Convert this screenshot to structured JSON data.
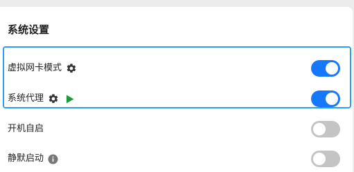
{
  "section": {
    "title": "系统设置"
  },
  "settings": [
    {
      "label": "虚拟网卡模式",
      "enabled": true,
      "icons": [
        "gear-icon"
      ]
    },
    {
      "label": "系统代理",
      "enabled": true,
      "icons": [
        "gear-icon",
        "play-icon"
      ]
    },
    {
      "label": "开机自启",
      "enabled": false,
      "icons": []
    },
    {
      "label": "静默启动",
      "enabled": false,
      "icons": [
        "info-icon"
      ]
    }
  ],
  "colors": {
    "toggle_on": "#1677ff",
    "toggle_off": "#c4c4c4",
    "highlight_border": "#2f9cf0",
    "play_icon": "#1a9b3c",
    "gear_icon": "#333333",
    "info_icon": "#777777"
  }
}
